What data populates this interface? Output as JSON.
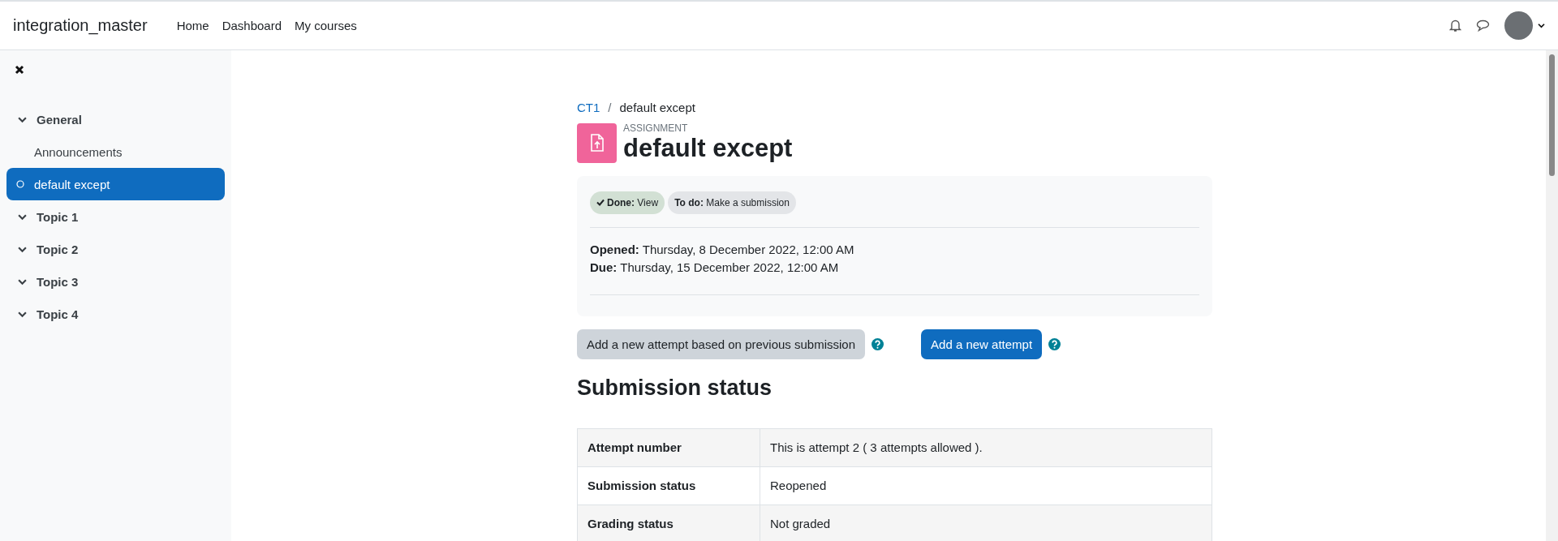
{
  "navbar": {
    "brand": "integration_master",
    "links": [
      "Home",
      "Dashboard",
      "My courses"
    ]
  },
  "sidebar": {
    "items": [
      {
        "label": "General",
        "kind": "section",
        "expanded": true,
        "selected": false
      },
      {
        "label": "Announcements",
        "kind": "activity",
        "tracked": false,
        "selected": false
      },
      {
        "label": "default except",
        "kind": "activity",
        "tracked": true,
        "selected": true
      },
      {
        "label": "Topic 1",
        "kind": "section",
        "expanded": true,
        "selected": false
      },
      {
        "label": "Topic 2",
        "kind": "section",
        "expanded": true,
        "selected": false
      },
      {
        "label": "Topic 3",
        "kind": "section",
        "expanded": true,
        "selected": false
      },
      {
        "label": "Topic 4",
        "kind": "section",
        "expanded": true,
        "selected": false
      }
    ]
  },
  "breadcrumb": {
    "separator": "/",
    "items": [
      {
        "label": "CT1",
        "kind": "link"
      },
      {
        "label": "default except",
        "kind": "current"
      }
    ]
  },
  "header": {
    "type_label": "ASSIGNMENT",
    "title": "default except"
  },
  "activity_info": {
    "badges": [
      {
        "text": "**Done:** View",
        "done": true
      },
      {
        "text": "**To do:** Make a submission",
        "done": false
      }
    ],
    "dates": [
      "**Opened:** Thursday, 8 December 2022, 12:00 AM",
      "**Due:** Thursday, 15 December 2022, 12:00 AM"
    ]
  },
  "actions": [
    {
      "label": "Add a new attempt based on previous submission",
      "kind": "secondary"
    },
    {
      "label": "Add a new attempt",
      "kind": "primary"
    }
  ],
  "submission_status": {
    "heading": "Submission status",
    "rows": [
      {
        "label": "Attempt number",
        "value": "This is attempt 2 ( 3 attempts allowed )."
      },
      {
        "label": "Submission status",
        "value": "Reopened"
      },
      {
        "label": "Grading status",
        "value": "Not graded"
      }
    ]
  }
}
